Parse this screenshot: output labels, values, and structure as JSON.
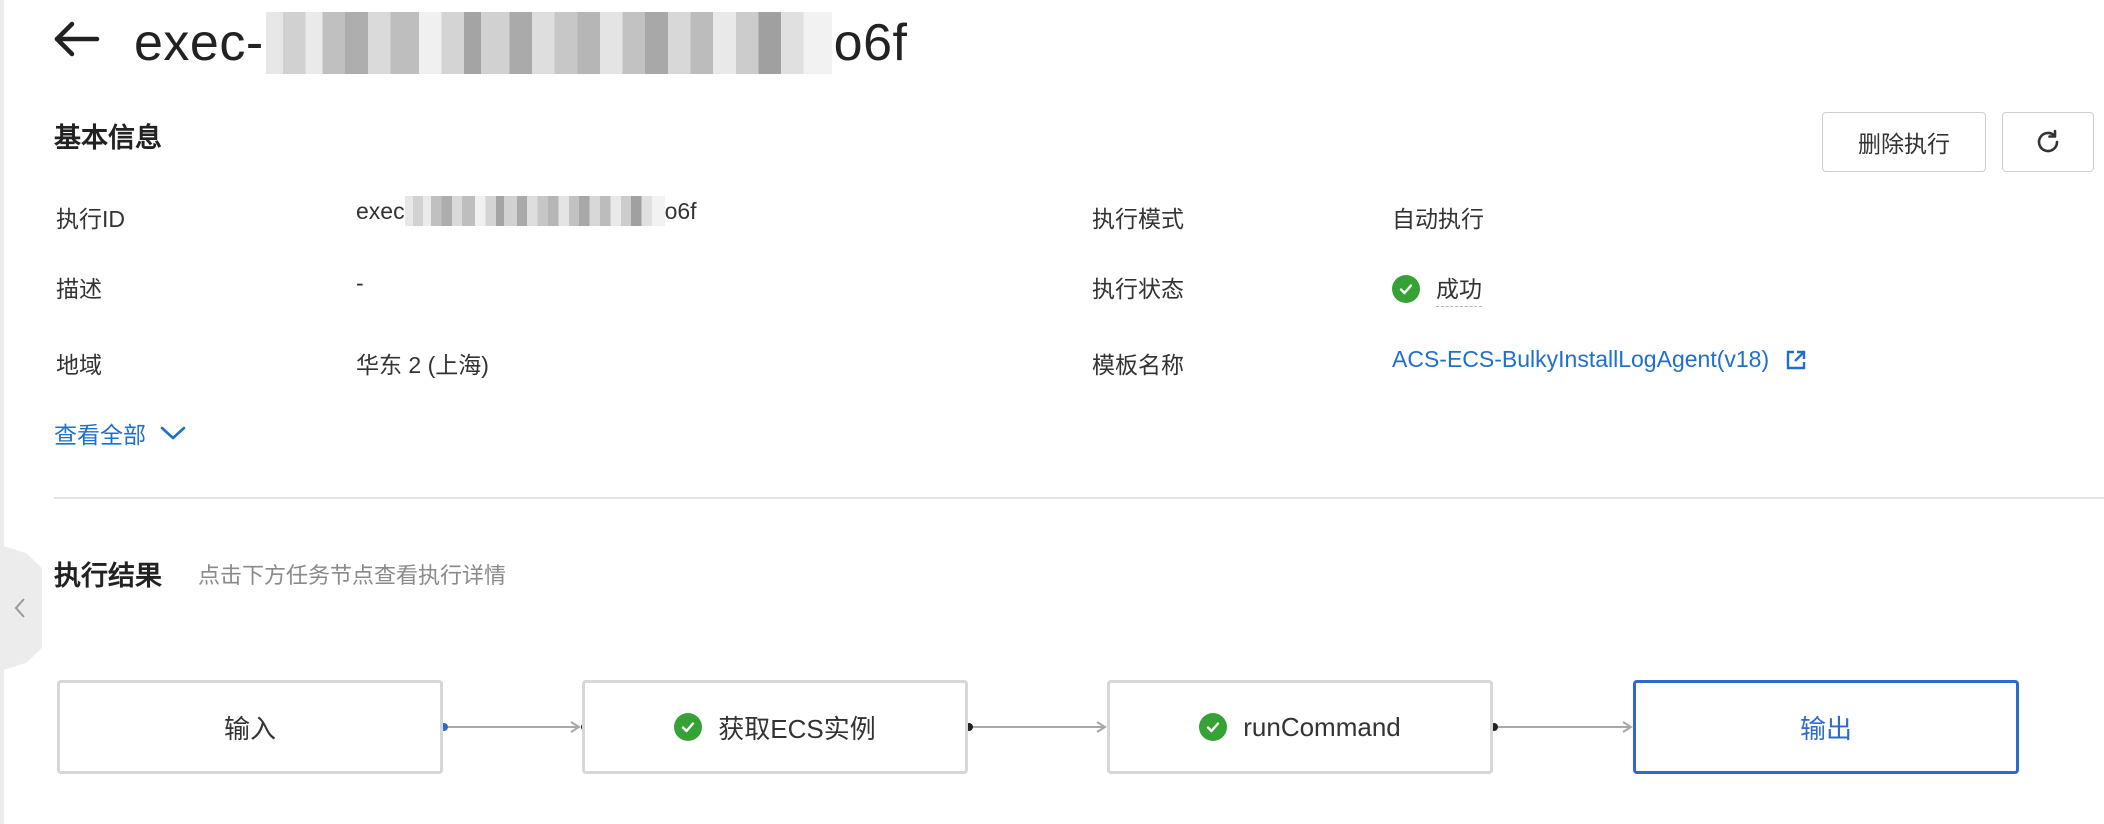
{
  "header": {
    "title_prefix": "exec-",
    "title_suffix": "o6f"
  },
  "basic_info": {
    "title": "基本信息",
    "buttons": {
      "delete_label": "删除执行",
      "refresh_icon": "refresh-icon"
    },
    "fields": {
      "exec_id_label": "执行ID",
      "exec_id_prefix": "exec",
      "exec_id_suffix": "o6f",
      "desc_label": "描述",
      "desc_value": "-",
      "region_label": "地域",
      "region_value": "华东 2 (上海)",
      "mode_label": "执行模式",
      "mode_value": "自动执行",
      "status_label": "执行状态",
      "status_value": "成功",
      "template_label": "模板名称",
      "template_value": "ACS-ECS-BulkyInstallLogAgent(v18)"
    },
    "view_all": "查看全部"
  },
  "results": {
    "title": "执行结果",
    "hint": "点击下方任务节点查看执行详情",
    "nodes": [
      {
        "label": "输入",
        "status": "none"
      },
      {
        "label": "获取ECS实例",
        "status": "success"
      },
      {
        "label": "runCommand",
        "status": "success"
      },
      {
        "label": "输出",
        "status": "active"
      }
    ]
  },
  "colors": {
    "accent": "#2e6ac9",
    "link": "#1f6fcc",
    "success": "#36a236"
  }
}
